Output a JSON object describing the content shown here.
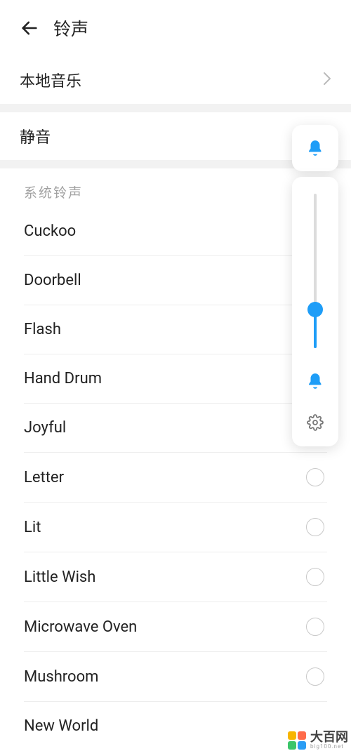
{
  "header": {
    "title": "铃声"
  },
  "localMusic": {
    "label": "本地音乐"
  },
  "mute": {
    "label": "静音"
  },
  "sectionLabel": "系统铃声",
  "ringtones": [
    {
      "name": "Cuckoo",
      "showRadio": false
    },
    {
      "name": "Doorbell",
      "showRadio": false
    },
    {
      "name": "Flash",
      "showRadio": false
    },
    {
      "name": "Hand Drum",
      "showRadio": false
    },
    {
      "name": "Joyful",
      "showRadio": false
    },
    {
      "name": "Letter",
      "showRadio": true
    },
    {
      "name": "Lit",
      "showRadio": true
    },
    {
      "name": "Little Wish",
      "showRadio": true
    },
    {
      "name": "Microwave Oven",
      "showRadio": true
    },
    {
      "name": "Mushroom",
      "showRadio": true
    }
  ],
  "cutoffItem": "New World",
  "volume": {
    "percent": 25
  },
  "watermark": {
    "main": "大百网",
    "sub": "big100.net",
    "colors": [
      "#f7b500",
      "#ff6b4a",
      "#3ac569",
      "#2a9df4"
    ]
  }
}
